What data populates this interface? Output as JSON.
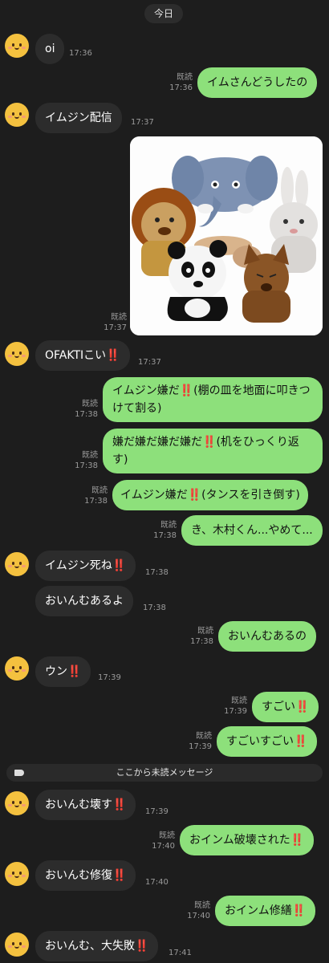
{
  "header": {
    "date_label": "今日"
  },
  "labels": {
    "read": "既読",
    "unread_divider": "ここから未読メッセージ"
  },
  "messages": [
    {
      "side": "in",
      "text": "oi",
      "time": "17:36"
    },
    {
      "side": "out",
      "text": "イムさんどうしたの",
      "time": "17:36",
      "read": true
    },
    {
      "side": "in",
      "text": "イムジン配信",
      "time": "17:37"
    },
    {
      "side": "out",
      "type": "image",
      "time": "17:37",
      "read": true,
      "image_desc": "animal puppets photo"
    },
    {
      "side": "in",
      "text": "OFAKTIこい",
      "bang": "‼️",
      "time": "17:37"
    },
    {
      "side": "out",
      "text": "イムジン嫌だ",
      "bang": "‼️",
      "text2": "(棚の皿を地面に叩きつけて割る)",
      "time": "17:38",
      "read": true
    },
    {
      "side": "out",
      "text": "嫌だ嫌だ嫌だ嫌だ",
      "bang": "‼️",
      "text2": "(机をひっくり返す)",
      "time": "17:38",
      "read": true
    },
    {
      "side": "out",
      "text": "イムジン嫌だ",
      "bang": "‼️",
      "text2": "(タンスを引き倒す)",
      "time": "17:38",
      "read": true
    },
    {
      "side": "out",
      "text": "き、木村くん...やめて...",
      "time": "17:38",
      "read": true
    },
    {
      "side": "in",
      "text": "イムジン死ね",
      "bang": "‼️",
      "time": "17:38"
    },
    {
      "side": "in",
      "text": "おいんむあるよ",
      "time": "17:38"
    },
    {
      "side": "out",
      "text": "おいんむあるの",
      "time": "17:38",
      "read": true
    },
    {
      "side": "in",
      "text": "ウン",
      "bang": "‼️",
      "time": "17:39"
    },
    {
      "side": "out",
      "text": "すごい",
      "bang": "‼️",
      "time": "17:39",
      "read": true
    },
    {
      "side": "out",
      "text": "すごいすごい",
      "bang": "‼️",
      "time": "17:39",
      "read": true
    },
    {
      "side": "in",
      "text": "おいんむ壊す",
      "bang": "‼️",
      "time": "17:39"
    },
    {
      "side": "out",
      "text": "おインム破壊された",
      "bang": "‼️",
      "time": "17:40",
      "read": true
    },
    {
      "side": "in",
      "text": "おいんむ修復",
      "bang": "‼️",
      "time": "17:40"
    },
    {
      "side": "out",
      "text": "おインム修繕",
      "bang": "‼️",
      "time": "17:40",
      "read": true
    },
    {
      "side": "in",
      "text": "おいんむ、大失敗",
      "bang": "‼️",
      "time": "17:41"
    }
  ],
  "colors": {
    "background": "#1d1d1d",
    "incoming_bubble": "#2c2c2c",
    "outgoing_bubble": "#8de07b",
    "exclamation": "#d6231a"
  }
}
